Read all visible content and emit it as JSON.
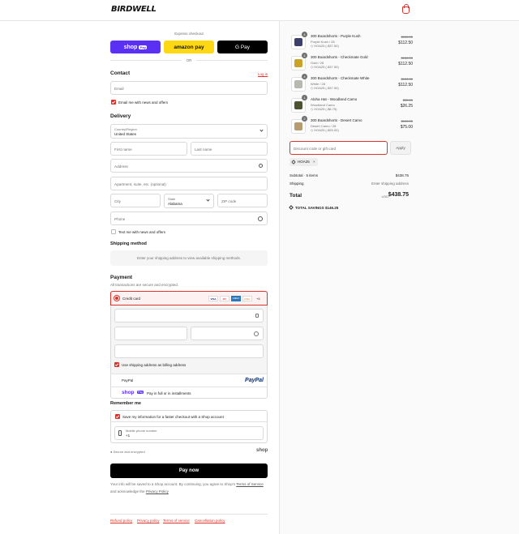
{
  "header": {
    "brand": "BIRDWELL"
  },
  "express": {
    "label": "Express checkout",
    "shop_pay": "shop",
    "shop_pay_badge": "Pay",
    "amazon_pay": "amazon pay",
    "google_pay": "G Pay",
    "or": "OR"
  },
  "contact": {
    "title": "Contact",
    "login": "Log in",
    "email_placeholder": "Email",
    "news_label": "Email me with news and offers"
  },
  "delivery": {
    "title": "Delivery",
    "country_label": "Country/Region",
    "country_value": "United States",
    "first_name": "First name",
    "last_name": "Last name",
    "address": "Address",
    "apartment": "Apartment, suite, etc. (optional)",
    "city": "City",
    "state_label": "State",
    "state_value": "Alabama",
    "zip": "ZIP code",
    "phone": "Phone",
    "text_label": "Text me with news and offers"
  },
  "shipping": {
    "title": "Shipping method",
    "message": "Enter your shipping address to view available shipping methods."
  },
  "payment": {
    "title": "Payment",
    "subtitle": "All transactions are secure and encrypted.",
    "credit_card": "Credit card",
    "card_brands": [
      "VISA",
      "MC",
      "AMEX",
      "DISC"
    ],
    "more_brands": "+4",
    "billing_label": "Use shipping address as billing address",
    "paypal": "PayPal",
    "paypal_logo": "PayPal",
    "shoppay_logo": "shop",
    "shoppay_badge": "Pay",
    "shoppay_label": "Pay in full or in installments"
  },
  "remember": {
    "title": "Remember me",
    "save_label": "Save my information for a faster checkout with a Shop account",
    "mobile_label": "Mobile phone number",
    "mobile_value": "+1",
    "secure": "Secure and encrypted",
    "shop": "shop"
  },
  "pay_now": "Pay now",
  "disclaimer": {
    "text": "Your info will be saved to a Shop account. By continuing, you agree to Shop's",
    "terms": "Terms of Service",
    "and": "and acknowledge the",
    "privacy": "Privacy Policy"
  },
  "footer": [
    "Refund policy",
    "Privacy policy",
    "Terms of service",
    "Cancellation policy"
  ],
  "cart": {
    "items": [
      {
        "qty": "4",
        "name": "300 Boardshorts - Purple Kush",
        "variant": "Purple Kush / 28",
        "discount": "HOA25 (-$37.50)",
        "orig": "$150.00",
        "price": "$112.50",
        "color": "#3a3f6b"
      },
      {
        "qty": "4",
        "name": "300 Boardshorts - Checkmate Gold",
        "variant": "Gold / 28",
        "discount": "HOA25 (-$37.50)",
        "orig": "$150.00",
        "price": "$112.50",
        "color": "#c9a227"
      },
      {
        "qty": "4",
        "name": "300 Boardshorts - Checkmate White",
        "variant": "White / 28",
        "discount": "HOA25 (-$37.50)",
        "orig": "$150.00",
        "price": "$112.50",
        "color": "#b8b8b0"
      },
      {
        "qty": "1",
        "name": "Aloha Hat - Woodland Camo",
        "variant": "Woodland Camo",
        "discount": "HOA25 (-$8.75)",
        "orig": "$35.00",
        "price": "$26.25",
        "color": "#4e5233"
      },
      {
        "qty": "2",
        "name": "300 Boardshorts - Desert Camo",
        "variant": "Desert Camo / 28",
        "discount": "HOA25 (-$25.00)",
        "orig": "$100.00",
        "price": "$75.00",
        "color": "#b59b6e"
      }
    ],
    "discount_placeholder": "Discount code or gift card",
    "apply": "Apply",
    "code_tag": "HOA25",
    "subtotal_label": "Subtotal · 5 items",
    "subtotal_value": "$438.75",
    "shipping_label": "Shipping",
    "shipping_value": "Enter shipping address",
    "total_label": "Total",
    "currency": "USD",
    "total_value": "$438.75",
    "savings_label": "TOTAL SAVINGS",
    "savings_value": "$146.25"
  }
}
